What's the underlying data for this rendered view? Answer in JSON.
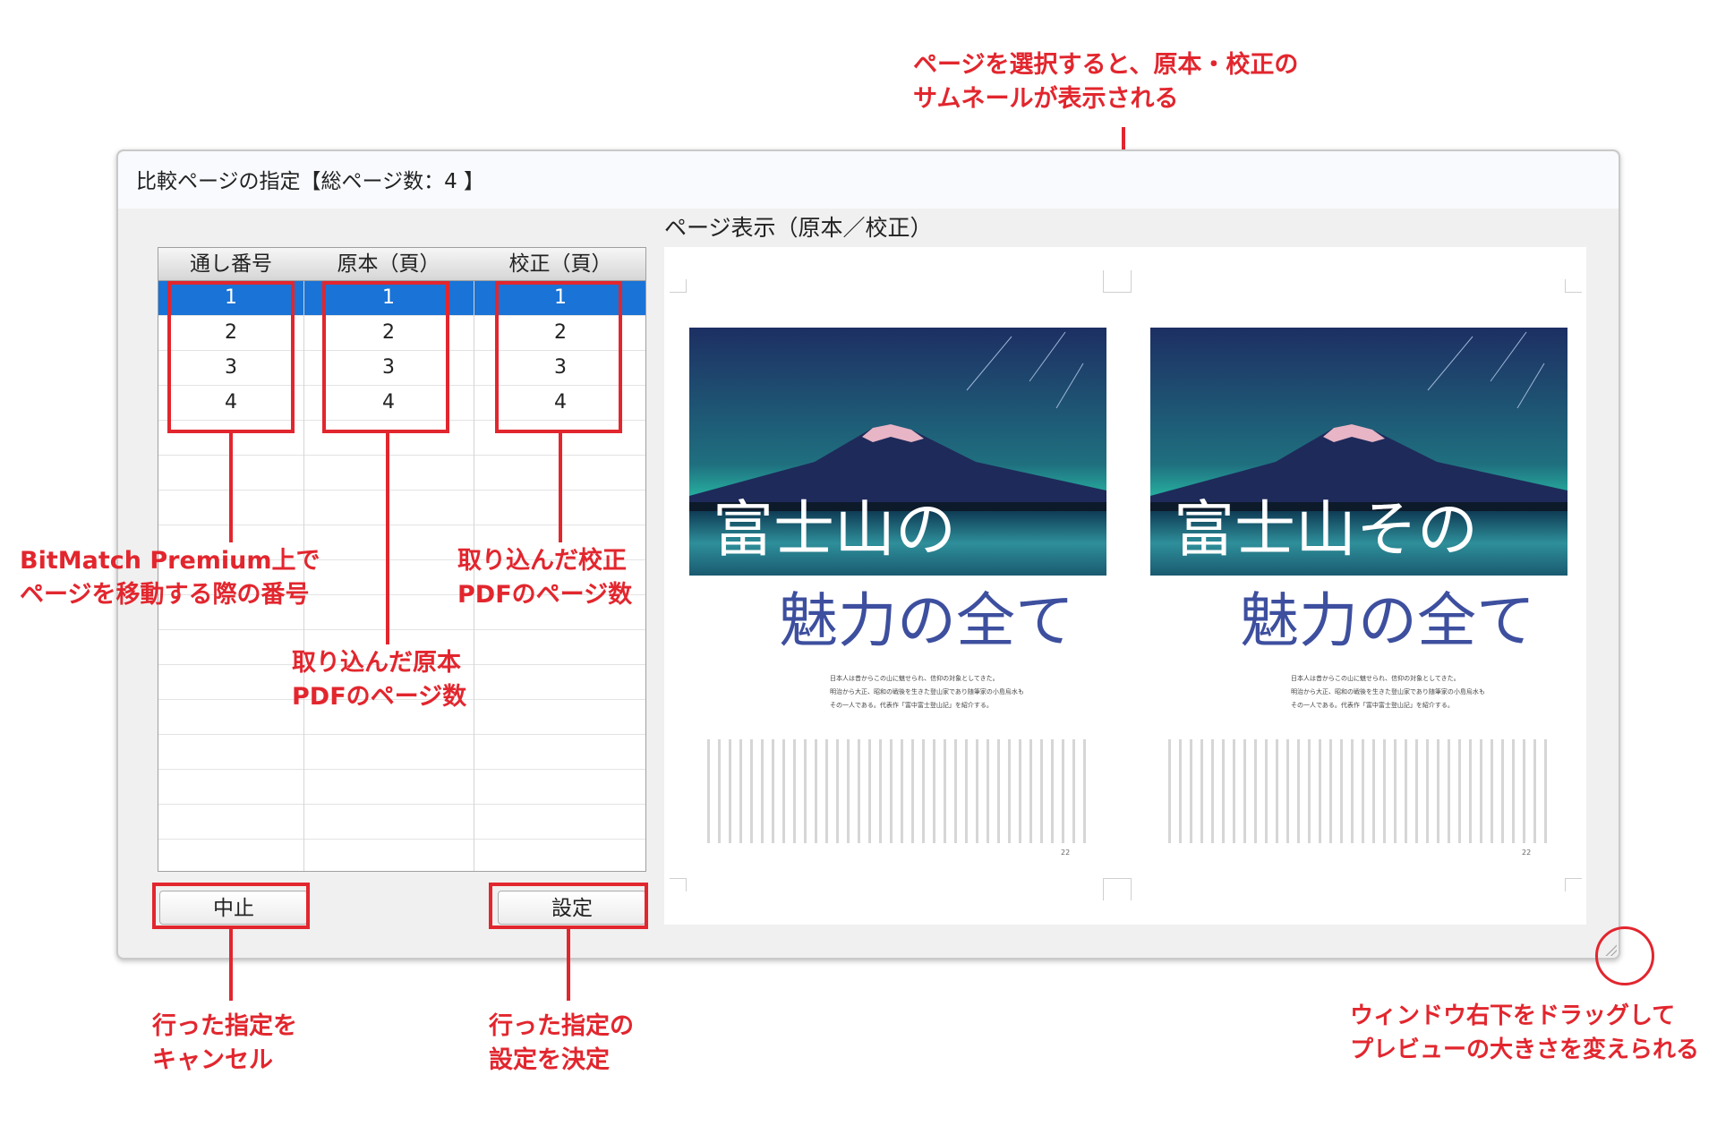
{
  "window": {
    "title": "比較ページの指定【総ページ数：4 】",
    "preview_label": "ページ表示（原本／校正）"
  },
  "table": {
    "headers": [
      "通し番号",
      "原本（頁）",
      "校正（頁）"
    ],
    "rows": [
      [
        "1",
        "1",
        "1"
      ],
      [
        "2",
        "2",
        "2"
      ],
      [
        "3",
        "3",
        "3"
      ],
      [
        "4",
        "4",
        "4"
      ]
    ],
    "selected_row": 0
  },
  "buttons": {
    "cancel": "中止",
    "set": "設定"
  },
  "preview": {
    "left_title_line1": "富士山の",
    "right_title_line1": "富士山その",
    "title_line2": "魅力の全て",
    "intro_lines": [
      "日本人は昔からこの山に魅せられ、信仰の対象としてきた。",
      "明治から大正、昭和の戦後を生きた登山家であり随筆家の小島烏水も",
      "その一人である。代表作「富中富士登山記」を紹介する。"
    ],
    "page_number": "22"
  },
  "annotations": {
    "top": [
      "ページを選択すると、原本・校正の",
      "サムネールが表示される"
    ],
    "serial": [
      "BitMatch Premium上で",
      "ページを移動する際の番号"
    ],
    "original": [
      "取り込んだ原本",
      "PDFのページ数"
    ],
    "proof": [
      "取り込んだ校正",
      "PDFのページ数"
    ],
    "cancel": [
      "行った指定を",
      "キャンセル"
    ],
    "set": [
      "行った指定の",
      "設定を決定"
    ],
    "resize": [
      "ウィンドウ右下をドラッグして",
      "プレビューの大きさを変えられる"
    ]
  },
  "colors": {
    "accent_red": "#e2262e",
    "selection_blue": "#1a73d6",
    "title_blue": "#3d4f9e"
  }
}
